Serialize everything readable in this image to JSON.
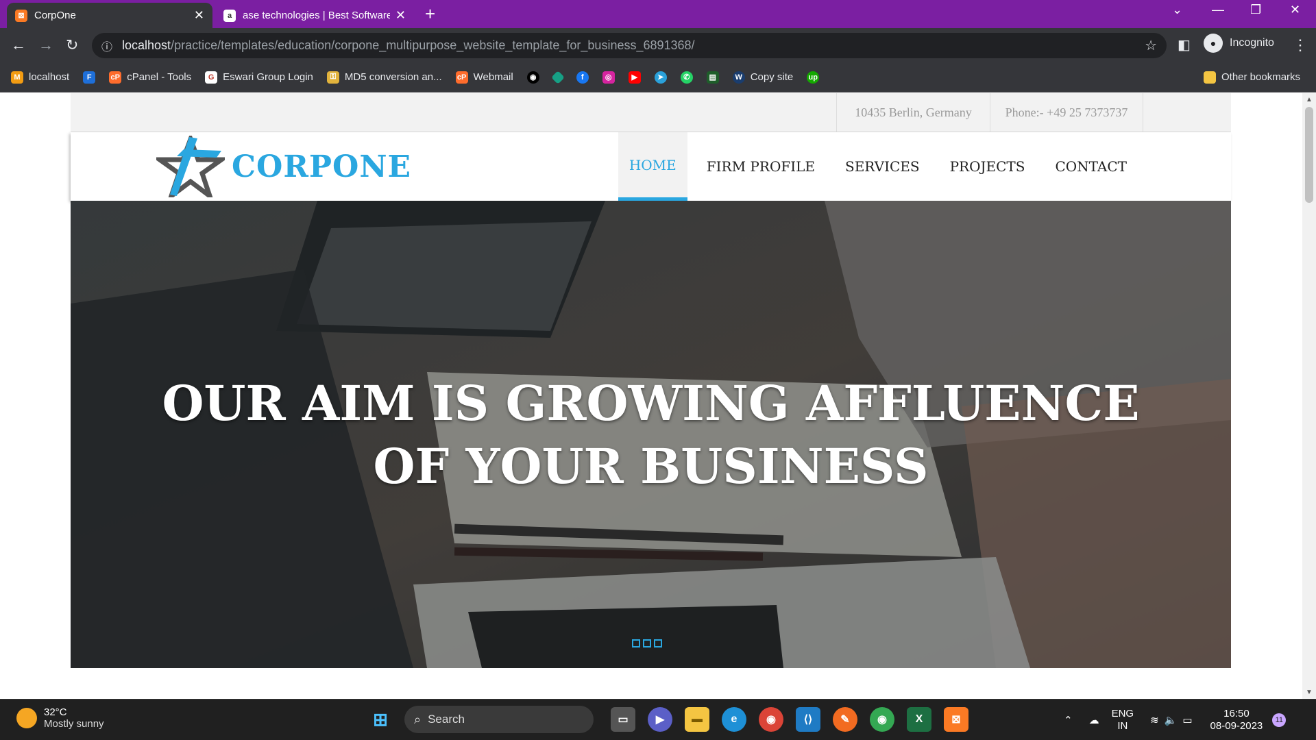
{
  "browser": {
    "tabs": [
      {
        "title": "CorpOne",
        "active": true
      },
      {
        "title": "ase technologies | Best Software",
        "active": false
      }
    ],
    "url_host": "localhost",
    "url_path": "/practice/templates/education/corpone_multipurpose_website_template_for_business_6891368/",
    "profile_label": "Incognito",
    "bookmarks": [
      {
        "label": "localhost",
        "icon": "xampp-icon"
      },
      {
        "label": "",
        "icon": "f-icon"
      },
      {
        "label": "cPanel - Tools",
        "icon": "cpanel-icon"
      },
      {
        "label": "Eswari Group Login",
        "icon": "eswari-icon"
      },
      {
        "label": "MD5 conversion an...",
        "icon": "key-icon"
      },
      {
        "label": "Webmail",
        "icon": "cpanel-icon"
      },
      {
        "label": "",
        "icon": "github-icon"
      },
      {
        "label": "",
        "icon": "diamond-icon"
      },
      {
        "label": "",
        "icon": "facebook-icon"
      },
      {
        "label": "",
        "icon": "instagram-icon"
      },
      {
        "label": "",
        "icon": "youtube-icon"
      },
      {
        "label": "",
        "icon": "telegram-icon"
      },
      {
        "label": "",
        "icon": "whatsapp-icon"
      },
      {
        "label": "",
        "icon": "green-icon"
      },
      {
        "label": "Copy site",
        "icon": "copysite-icon"
      },
      {
        "label": "",
        "icon": "upwork-icon"
      }
    ],
    "other_bookmarks": "Other bookmarks"
  },
  "site": {
    "address": "10435 Berlin, Germany",
    "phone": "Phone:- +49 25 7373737",
    "logo_text": "CORPONE",
    "nav": [
      {
        "label": "HOME",
        "active": true
      },
      {
        "label": "FIRM PROFILE",
        "active": false
      },
      {
        "label": "SERVICES",
        "active": false
      },
      {
        "label": "PROJECTS",
        "active": false
      },
      {
        "label": "CONTACT",
        "active": false
      }
    ],
    "hero_line1": "OUR AIM IS GROWING AFFLUENCE",
    "hero_line2": "OF YOUR BUSINESS",
    "slides": 3,
    "accent": "#2aa7e0"
  },
  "taskbar": {
    "temperature": "32°C",
    "weather": "Mostly sunny",
    "search_label": "Search",
    "lang1": "ENG",
    "lang2": "IN",
    "time": "16:50",
    "date": "08-09-2023",
    "notifications": "11"
  }
}
